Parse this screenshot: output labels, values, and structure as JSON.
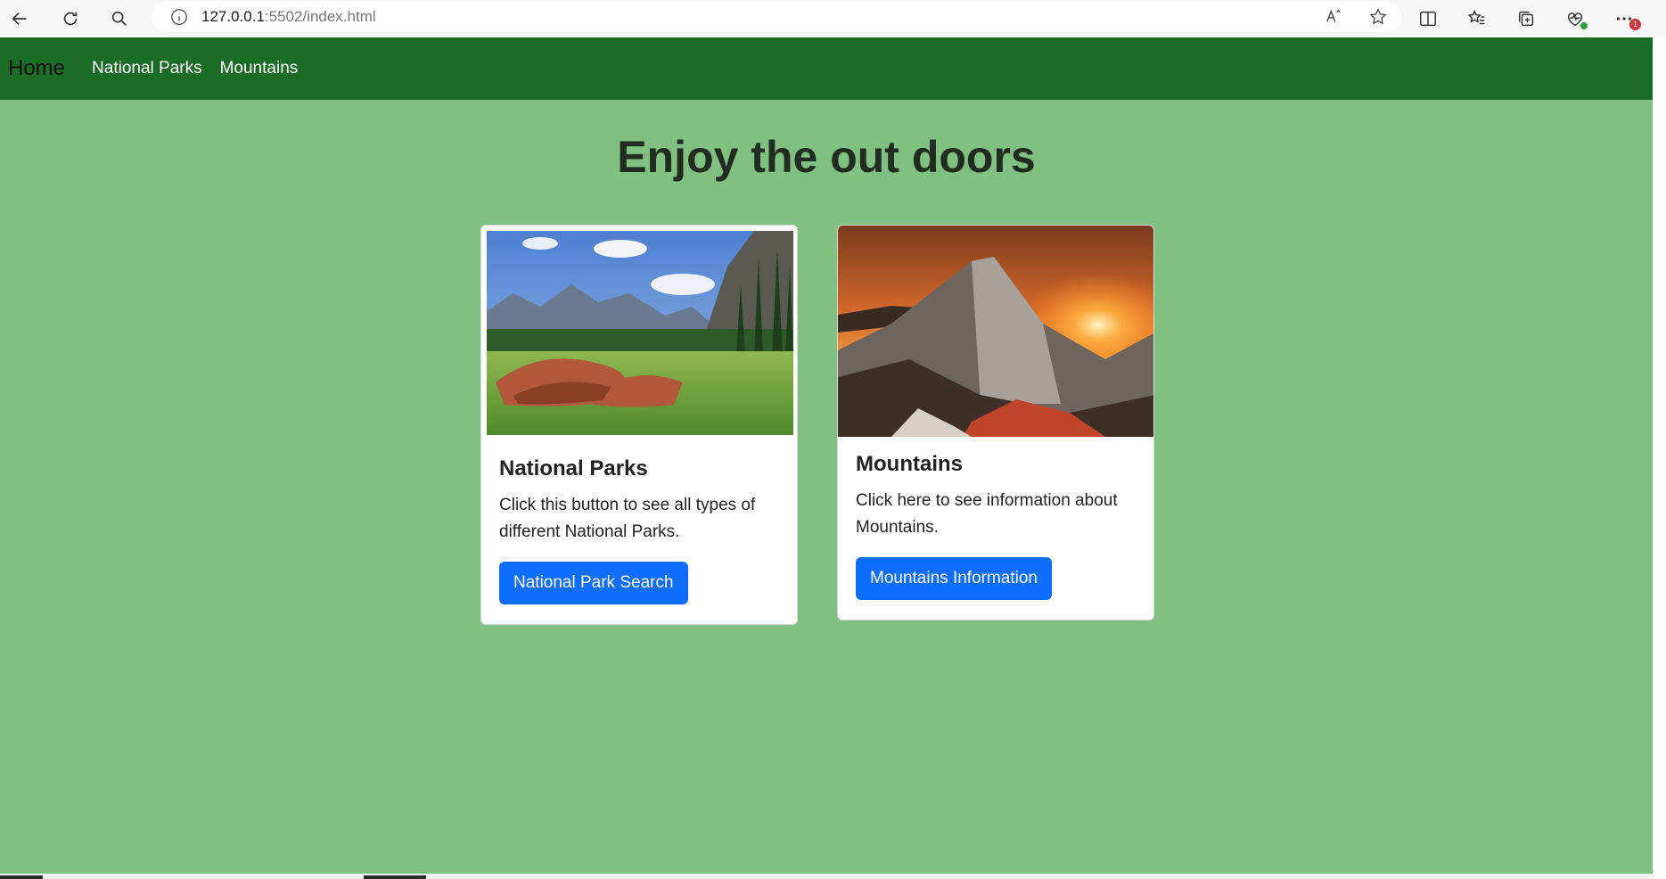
{
  "browser": {
    "url_host": "127.0.0.1",
    "url_path": ":5502/index.html",
    "extension_badge": "1",
    "icons": [
      "back-icon",
      "refresh-icon",
      "search-icon",
      "info-icon",
      "read-aloud-icon",
      "favorite-star-icon",
      "split-screen-icon",
      "favorites-icon",
      "collections-icon",
      "browser-essentials-icon",
      "more-icon"
    ]
  },
  "navbar": {
    "brand": "Home",
    "links": [
      "National Parks",
      "Mountains"
    ],
    "background": "#1b6d26"
  },
  "page": {
    "title": "Enjoy the out doors",
    "background": "#80c080"
  },
  "cards": [
    {
      "title": "National Parks",
      "text": "Click this button to see all types of different National Parks.",
      "button": "National Park Search",
      "image": "meadow-valley-landscape"
    },
    {
      "title": "Mountains",
      "text": "Click here to see information about Mountains.",
      "button": "Mountains Information",
      "image": "mountain-peak-sunset"
    }
  ],
  "colors": {
    "button": "#0d6efd"
  }
}
